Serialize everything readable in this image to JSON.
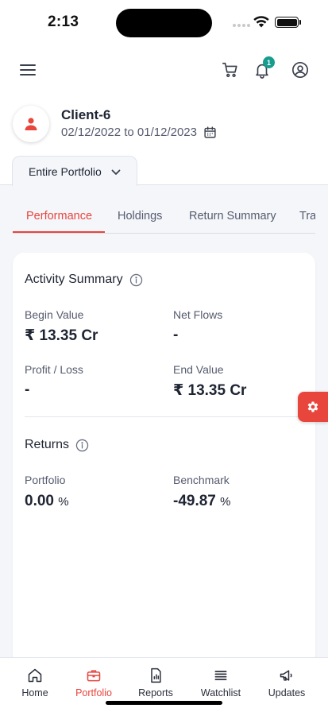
{
  "status_bar": {
    "time": "2:13"
  },
  "header": {
    "notification_count": "1",
    "icons": [
      "menu-icon",
      "cart-icon",
      "bell-icon",
      "profile-icon"
    ]
  },
  "client": {
    "name": "Client-6",
    "date_range": "02/12/2022 to 01/12/2023"
  },
  "portfolio_selector": {
    "label": "Entire Portfolio"
  },
  "tabs": [
    {
      "label": "Performance",
      "active": true
    },
    {
      "label": "Holdings"
    },
    {
      "label": "Return Summary"
    },
    {
      "label": "Tra"
    }
  ],
  "activity_summary": {
    "title": "Activity Summary",
    "begin_value": {
      "label": "Begin Value",
      "value": "₹ 13.35 Cr"
    },
    "net_flows": {
      "label": "Net Flows",
      "value": "-"
    },
    "profit_loss": {
      "label": "Profit / Loss",
      "value": "-"
    },
    "end_value": {
      "label": "End Value",
      "value": "₹ 13.35 Cr"
    }
  },
  "returns": {
    "title": "Returns",
    "portfolio": {
      "label": "Portfolio",
      "value": "0.00",
      "unit": "%"
    },
    "benchmark": {
      "label": "Benchmark",
      "value": "-49.87",
      "unit": "%"
    }
  },
  "bottom_nav": [
    {
      "label": "Home",
      "icon": "home-icon"
    },
    {
      "label": "Portfolio",
      "icon": "briefcase-icon",
      "active": true
    },
    {
      "label": "Reports",
      "icon": "report-icon"
    },
    {
      "label": "Watchlist",
      "icon": "list-icon"
    },
    {
      "label": "Updates",
      "icon": "megaphone-icon"
    }
  ],
  "colors": {
    "accent": "#e8453c",
    "badge": "#179c8e",
    "background": "#f4f6fa"
  }
}
